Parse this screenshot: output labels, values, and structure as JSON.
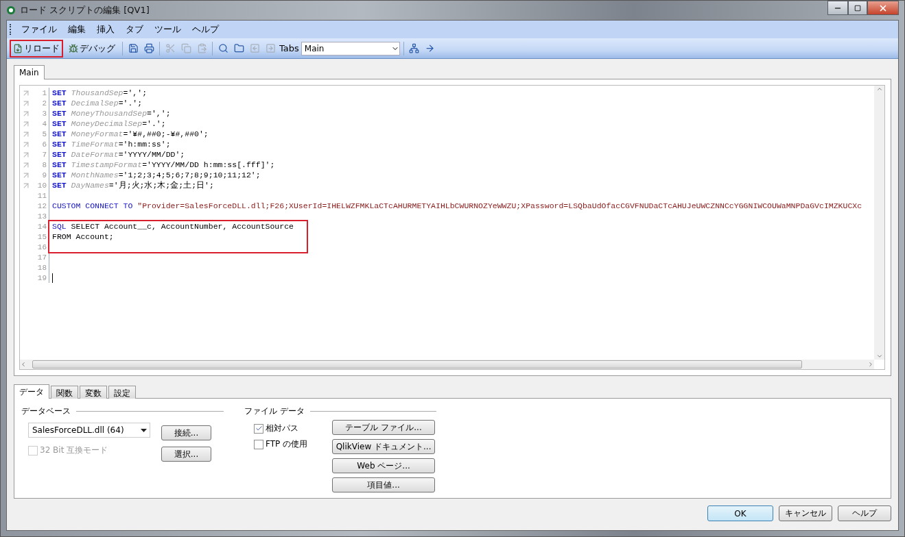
{
  "window": {
    "title": "ロード スクリプトの編集 [QV1]"
  },
  "menu": [
    "ファイル",
    "編集",
    "挿入",
    "タブ",
    "ツール",
    "ヘルプ"
  ],
  "toolbar": {
    "items": [
      {
        "kind": "text_button",
        "label": "リロード",
        "highlighted": true
      },
      {
        "kind": "text_button",
        "label": "デバッグ",
        "highlighted": false
      },
      {
        "kind": "separator"
      },
      {
        "kind": "icon",
        "disabled": false
      },
      {
        "kind": "icon",
        "disabled": false
      },
      {
        "kind": "separator"
      },
      {
        "kind": "icon",
        "disabled": true
      },
      {
        "kind": "icon",
        "disabled": true
      },
      {
        "kind": "icon",
        "disabled": true
      },
      {
        "kind": "separator"
      },
      {
        "kind": "icon",
        "disabled": false
      },
      {
        "kind": "icon",
        "disabled": false
      },
      {
        "kind": "icon",
        "disabled": true
      },
      {
        "kind": "icon",
        "disabled": true
      },
      {
        "kind": "label",
        "label": "Tabs"
      },
      {
        "kind": "select",
        "value": "Main"
      },
      {
        "kind": "separator"
      },
      {
        "kind": "icon",
        "disabled": false
      },
      {
        "kind": "icon",
        "disabled": false
      }
    ]
  },
  "script_tabs": [
    {
      "label": "Main",
      "selected": true
    }
  ],
  "editor": {
    "lines": [
      {
        "number": "1",
        "bookmark": true,
        "highlighted": false,
        "tokens": [
          {
            "kind": "keyword_bold",
            "text": "SET "
          },
          {
            "kind": "variable",
            "text": "ThousandSep"
          },
          {
            "kind": "text",
            "text": "=',';"
          }
        ]
      },
      {
        "number": "2",
        "bookmark": true,
        "highlighted": false,
        "tokens": [
          {
            "kind": "keyword_bold",
            "text": "SET "
          },
          {
            "kind": "variable",
            "text": "DecimalSep"
          },
          {
            "kind": "text",
            "text": "='.';"
          }
        ]
      },
      {
        "number": "3",
        "bookmark": true,
        "highlighted": false,
        "tokens": [
          {
            "kind": "keyword_bold",
            "text": "SET "
          },
          {
            "kind": "variable",
            "text": "MoneyThousandSep"
          },
          {
            "kind": "text",
            "text": "=',';"
          }
        ]
      },
      {
        "number": "4",
        "bookmark": true,
        "highlighted": false,
        "tokens": [
          {
            "kind": "keyword_bold",
            "text": "SET "
          },
          {
            "kind": "variable",
            "text": "MoneyDecimalSep"
          },
          {
            "kind": "text",
            "text": "='.';"
          }
        ]
      },
      {
        "number": "5",
        "bookmark": true,
        "highlighted": false,
        "tokens": [
          {
            "kind": "keyword_bold",
            "text": "SET "
          },
          {
            "kind": "variable",
            "text": "MoneyFormat"
          },
          {
            "kind": "text",
            "text": "='¥#,##0;-¥#,##0';"
          }
        ]
      },
      {
        "number": "6",
        "bookmark": true,
        "highlighted": false,
        "tokens": [
          {
            "kind": "keyword_bold",
            "text": "SET "
          },
          {
            "kind": "variable",
            "text": "TimeFormat"
          },
          {
            "kind": "text",
            "text": "='h:mm:ss';"
          }
        ]
      },
      {
        "number": "7",
        "bookmark": true,
        "highlighted": false,
        "tokens": [
          {
            "kind": "keyword_bold",
            "text": "SET "
          },
          {
            "kind": "variable",
            "text": "DateFormat"
          },
          {
            "kind": "text",
            "text": "='YYYY/MM/DD';"
          }
        ]
      },
      {
        "number": "8",
        "bookmark": true,
        "highlighted": false,
        "tokens": [
          {
            "kind": "keyword_bold",
            "text": "SET "
          },
          {
            "kind": "variable",
            "text": "TimestampFormat"
          },
          {
            "kind": "text",
            "text": "='YYYY/MM/DD h:mm:ss[.fff]';"
          }
        ]
      },
      {
        "number": "9",
        "bookmark": true,
        "highlighted": false,
        "tokens": [
          {
            "kind": "keyword_bold",
            "text": "SET "
          },
          {
            "kind": "variable",
            "text": "MonthNames"
          },
          {
            "kind": "text",
            "text": "='1;2;3;4;5;6;7;8;9;10;11;12';"
          }
        ]
      },
      {
        "number": "10",
        "bookmark": true,
        "highlighted": false,
        "tokens": [
          {
            "kind": "keyword_bold",
            "text": "SET "
          },
          {
            "kind": "variable",
            "text": "DayNames"
          },
          {
            "kind": "text",
            "text": "='月;火;水;木;金;土;日';"
          }
        ]
      },
      {
        "number": "11",
        "bookmark": false,
        "highlighted": false
      },
      {
        "number": "12",
        "bookmark": false,
        "highlighted": false,
        "tokens": [
          {
            "kind": "keyword",
            "text": "CUSTOM CONNECT TO "
          },
          {
            "kind": "string",
            "text": "\"Provider=SalesForceDLL.dll;F26;XUserId=IHELWZFMKLaCTcAHURMETYAIHLbCWURNOZYeWWZU;XPassword=LSQbaUdOfacCGVFNUDaCTcAHUJeUWCZNNCcYGGNIWCOUWaMNPDaGVcIMZKUCXc"
          }
        ]
      },
      {
        "number": "13",
        "bookmark": false,
        "highlighted": false
      },
      {
        "number": "14",
        "bookmark": false,
        "highlighted": true,
        "tokens": [
          {
            "kind": "keyword",
            "text": "SQL"
          },
          {
            "kind": "text",
            "text": " SELECT Account__c, AccountNumber, AccountSource"
          }
        ]
      },
      {
        "number": "15",
        "bookmark": false,
        "highlighted": true,
        "tokens": [
          {
            "kind": "text",
            "text": "FROM Account;"
          }
        ]
      },
      {
        "number": "16",
        "bookmark": false,
        "highlighted": true
      },
      {
        "number": "17",
        "bookmark": false,
        "highlighted": false
      },
      {
        "number": "18",
        "bookmark": false,
        "highlighted": false
      },
      {
        "number": "19",
        "bookmark": false,
        "highlighted": false,
        "cursor": true
      }
    ]
  },
  "panel_tabs": [
    {
      "label": "データ",
      "selected": true
    },
    {
      "label": "関数",
      "selected": false
    },
    {
      "label": "変数",
      "selected": false
    },
    {
      "label": "設定",
      "selected": false
    }
  ],
  "database": {
    "title": "データベース",
    "dropdown": "SalesForceDLL.dll (64)",
    "buttons": [
      "接続...",
      "選択..."
    ],
    "compat": {
      "label": "32 Bit 互換モード",
      "checked": false,
      "disabled": true
    }
  },
  "file_data": {
    "title": "ファイル データ",
    "checkboxes": [
      {
        "label": "相対パス",
        "checked": true
      },
      {
        "label": "FTP の使用",
        "checked": false
      }
    ],
    "buttons": [
      "テーブル ファイル...",
      "QlikView ドキュメント...",
      "Web ページ...",
      "項目値..."
    ]
  },
  "footer": {
    "buttons": [
      {
        "label": "OK",
        "default": true
      },
      {
        "label": "キャンセル",
        "default": false
      },
      {
        "label": "ヘルプ",
        "default": false
      }
    ]
  }
}
